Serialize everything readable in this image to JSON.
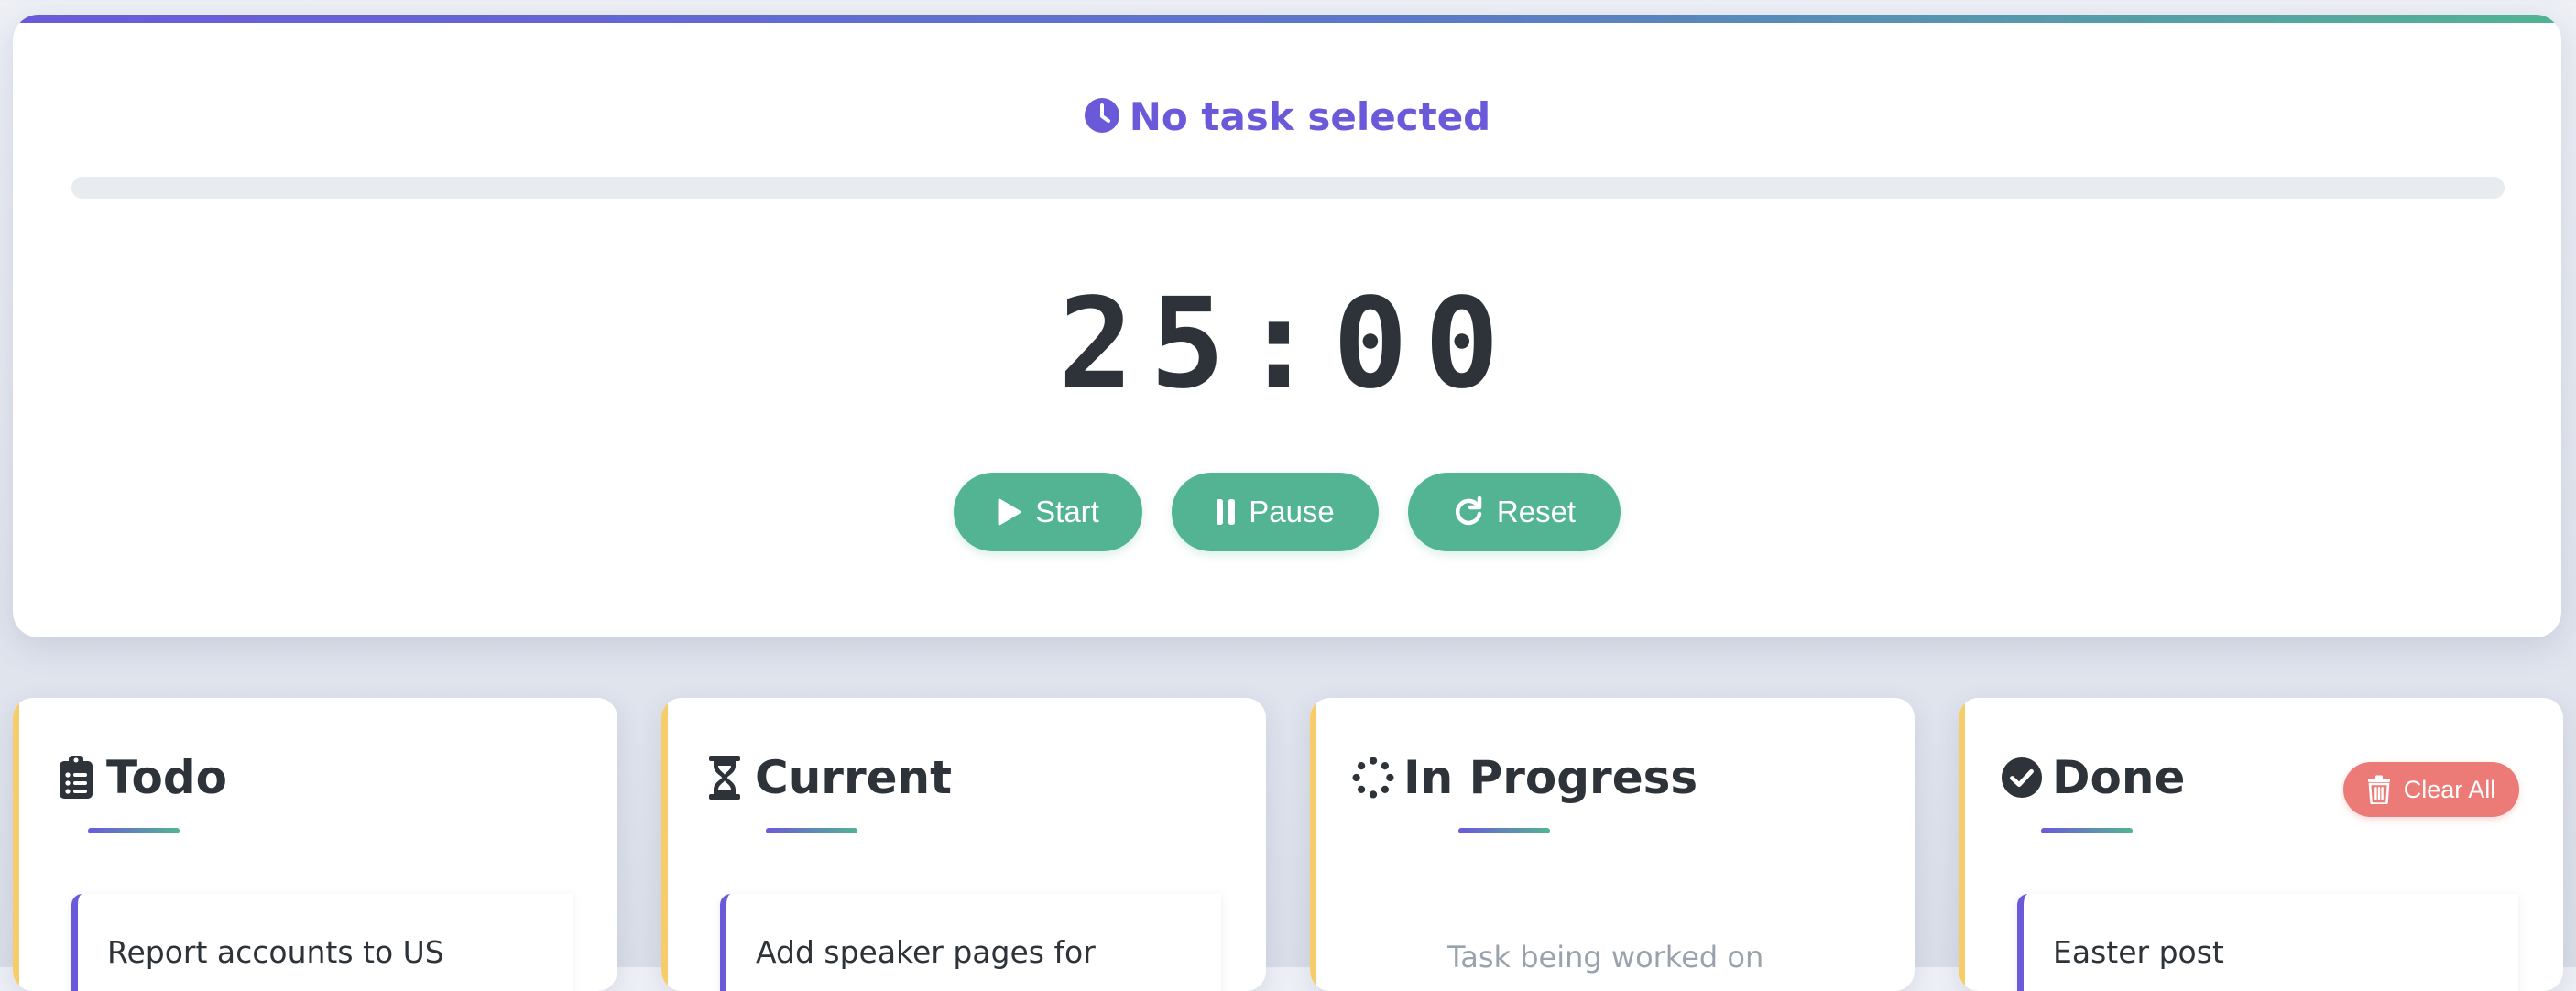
{
  "timer": {
    "status_text": "No task selected",
    "time": "25:00",
    "progress_fraction": 0,
    "buttons": {
      "start_label": "Start",
      "pause_label": "Pause",
      "reset_label": "Reset"
    }
  },
  "columns": {
    "todo": {
      "title": "Todo",
      "icon": "clipboard-list-icon",
      "tasks": [
        "Report accounts to US"
      ]
    },
    "current": {
      "title": "Current",
      "icon": "hourglass-icon",
      "tasks": [
        "Add speaker pages for"
      ]
    },
    "in_progress": {
      "title": "In Progress",
      "icon": "spinner-icon",
      "empty_text": "Task being worked on"
    },
    "done": {
      "title": "Done",
      "icon": "check-circle-icon",
      "clear_label": "Clear All",
      "tasks": [
        "Easter post"
      ]
    }
  },
  "colors": {
    "accent_purple": "#6a5ad9",
    "accent_green": "#52b493",
    "column_edge_yellow": "#f7cd6c",
    "danger_red": "#ec7a77",
    "text_dark": "#2d3339"
  }
}
